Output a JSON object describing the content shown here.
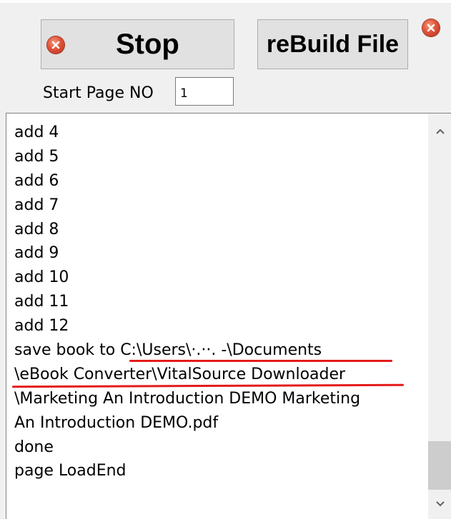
{
  "toolbar": {
    "stop_label": "Stop",
    "rebuild_label": "reBuild File"
  },
  "start_page": {
    "label": "Start Page NO",
    "value": "1"
  },
  "log": [
    "add 4",
    "add 5",
    "add 6",
    "add 7",
    "add 8",
    "add 9",
    "add 10",
    "add 11",
    "add 12",
    "save book to C:\\Users\\·.··. -\\Documents",
    "\\eBook Converter\\VitalSource Downloader",
    "\\Marketing An Introduction DEMO Marketing",
    "An Introduction DEMO.pdf",
    "done",
    "page LoadEnd"
  ],
  "colors": {
    "annotation_red": "#e41b1b",
    "close_icon_red": "#e0533a"
  },
  "icons": {
    "stop": "close-circle-icon",
    "window_close": "close-circle-icon",
    "scroll_up": "chevron-up-icon",
    "scroll_down": "chevron-down-icon"
  }
}
